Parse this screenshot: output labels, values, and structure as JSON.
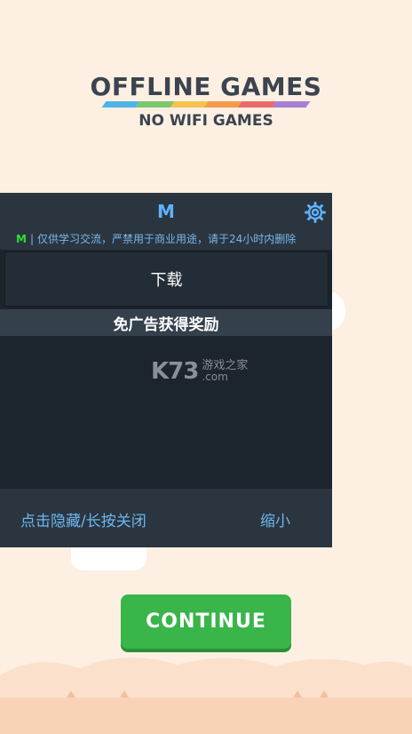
{
  "game": {
    "logo_title": "OFFLINE GAMES",
    "logo_subtitle": "NO WIFI GAMES",
    "rainbow_colors": [
      "#4fb3e8",
      "#7bc86c",
      "#f4c34d",
      "#f39b4b",
      "#ea6a6a",
      "#a77fd0"
    ],
    "continue_label": "CONTINUE",
    "continue_color": "#39b54a"
  },
  "overlay": {
    "title": "M",
    "settings_icon": "gear-icon",
    "notice_badge": "M",
    "notice_separator": "|",
    "notice_text": "仅供学习交流，严禁用于商业用途，请于24小时内删除",
    "download_label": "下载",
    "reward_label": "免广告获得奖励",
    "hide_label": "点击隐藏/长按关闭",
    "shrink_label": "缩小",
    "accent_color": "#5fb2ff"
  },
  "watermark": {
    "brand": "K73",
    "text_cn": "游戏之家",
    "text_com": ".com"
  }
}
